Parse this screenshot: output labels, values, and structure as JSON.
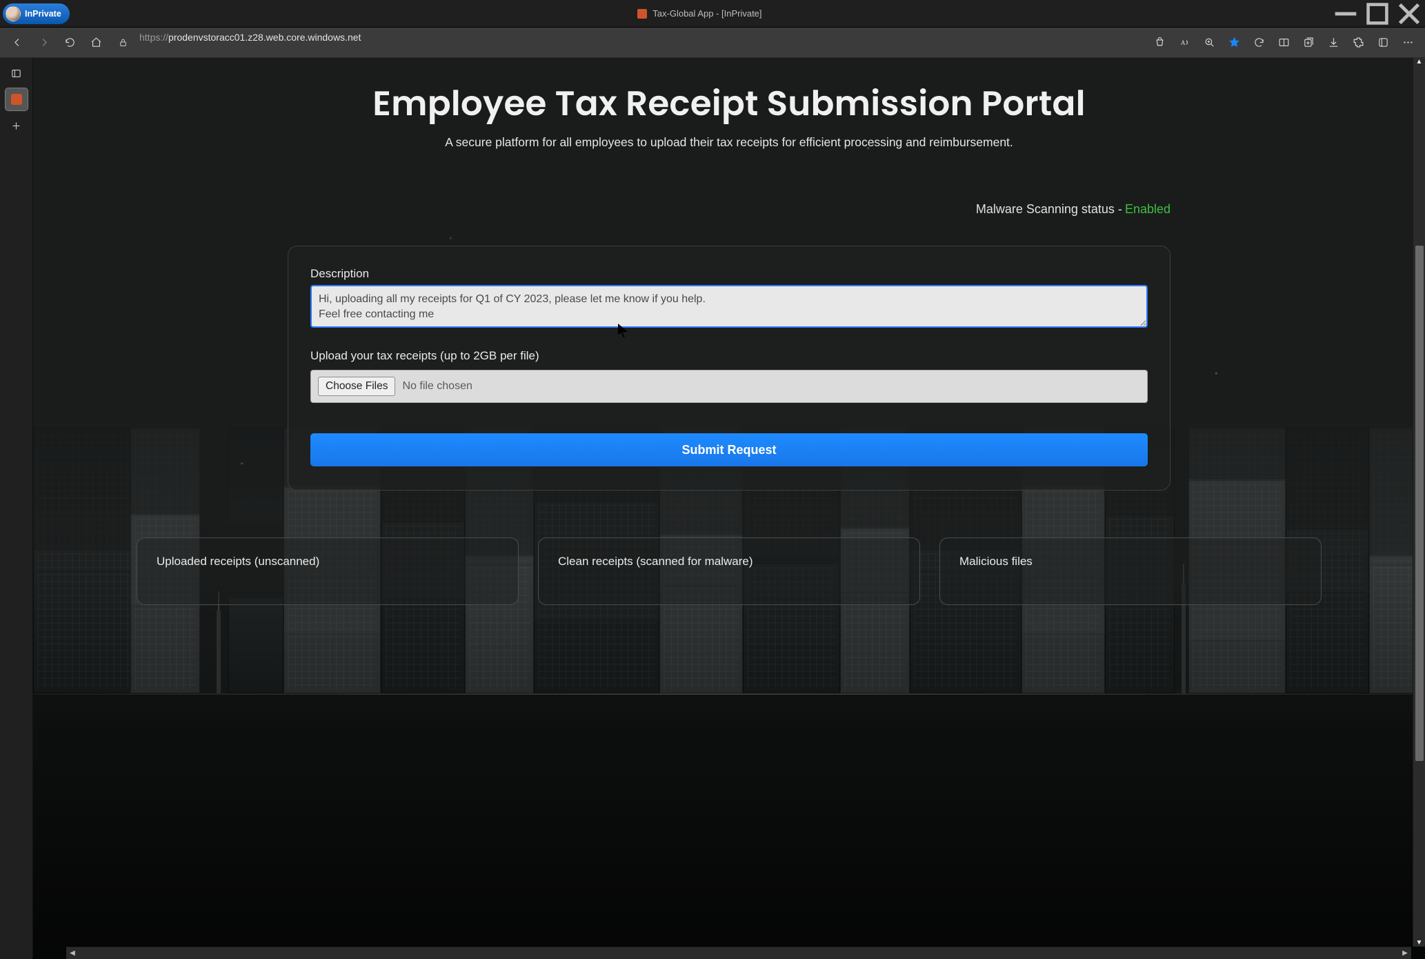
{
  "window": {
    "inprivate_label": "InPrivate",
    "tab_title": "Tax-Global App - [InPrivate]"
  },
  "addressbar": {
    "scheme": "https://",
    "host": "prodenvstoracc01.z28.web.core.windows.net"
  },
  "page": {
    "title": "Employee Tax Receipt Submission Portal",
    "subtitle": "A secure platform for all employees to upload their tax receipts for efficient processing and reimbursement."
  },
  "status": {
    "label": "Malware Scanning status - ",
    "value": "Enabled"
  },
  "form": {
    "description_label": "Description",
    "description_value": "Hi, uploading all my receipts for Q1 of CY 2023, please let me know if you help.\nFeel free contacting me",
    "upload_label": "Upload your tax receipts (up to 2GB per file)",
    "choose_files_label": "Choose Files",
    "file_status": "No file chosen",
    "submit_label": "Submit Request"
  },
  "panels": {
    "uploaded": "Uploaded receipts (unscanned)",
    "clean": "Clean receipts (scanned for malware)",
    "malicious": "Malicious files"
  }
}
